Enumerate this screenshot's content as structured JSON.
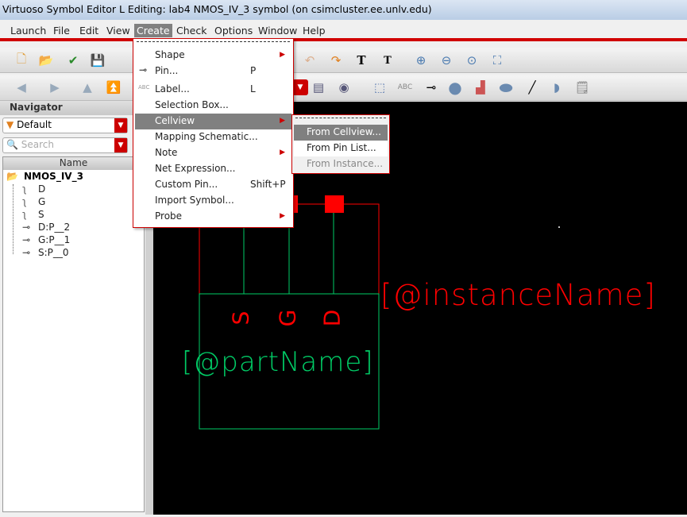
{
  "window": {
    "title": "Virtuoso Symbol Editor L Editing: lab4 NMOS_IV_3 symbol (on csimcluster.ee.unlv.edu)"
  },
  "menubar": [
    "Launch",
    "File",
    "Edit",
    "View",
    "Create",
    "Check",
    "Options",
    "Window",
    "Help"
  ],
  "navigator": {
    "title": "Navigator",
    "filter": "Default",
    "search_placeholder": "Search",
    "column": "Name",
    "root": "NMOS_IV_3",
    "items": [
      "D",
      "G",
      "S",
      "D:P__2",
      "G:P__1",
      "S:P__0"
    ]
  },
  "create_menu": [
    {
      "label": "Shape",
      "submenu": true
    },
    {
      "label": "Pin...",
      "shortcut": "P",
      "icon": "pin-icon"
    },
    {
      "label": "Label...",
      "shortcut": "L",
      "icon": "label-icon"
    },
    {
      "label": "Selection Box..."
    },
    {
      "label": "Cellview",
      "submenu": true,
      "highlighted": true
    },
    {
      "label": "Mapping Schematic..."
    },
    {
      "label": "Note",
      "submenu": true
    },
    {
      "label": "Net Expression..."
    },
    {
      "label": "Custom Pin...",
      "shortcut": "Shift+P"
    },
    {
      "label": "Import Symbol..."
    },
    {
      "label": "Probe",
      "submenu": true
    }
  ],
  "cellview_submenu": [
    {
      "label": "From Cellview...",
      "highlighted": true
    },
    {
      "label": "From Pin List..."
    },
    {
      "label": "From Instance...",
      "disabled": true
    }
  ],
  "canvas": {
    "instance_label": "[@instanceName]",
    "part_label": "[@partName]",
    "pin_labels": [
      "S",
      "G",
      "D"
    ],
    "colors": {
      "background": "#000000",
      "device": "#00cc66",
      "selection": "#ff0000"
    }
  }
}
